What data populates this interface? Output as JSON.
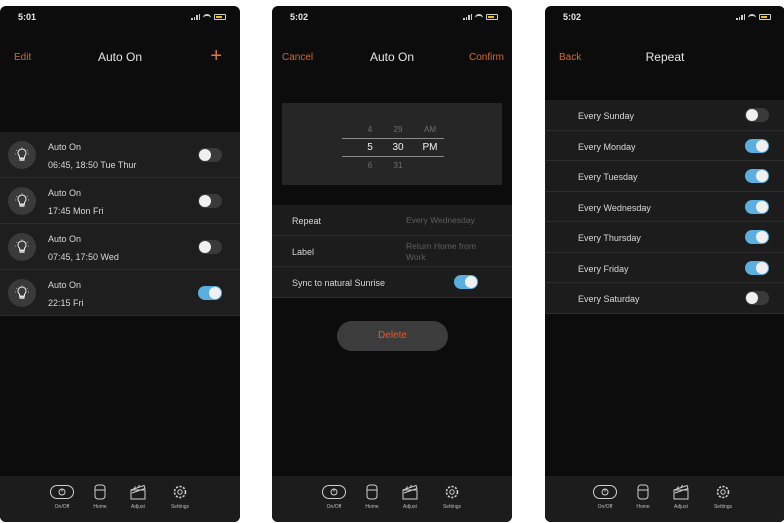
{
  "screens": [
    {
      "status_time": "5:01",
      "nav": {
        "left": "Edit",
        "title": "Auto On",
        "right_icon": "plus-icon",
        "right": "+"
      },
      "schedules": [
        {
          "name": "Auto On",
          "schedule": "06:45, 18:50 Tue Thur",
          "enabled": false
        },
        {
          "name": "Auto On",
          "schedule": "17:45 Mon Fri",
          "enabled": false
        },
        {
          "name": "Auto On",
          "schedule": "07:45, 17:50 Wed",
          "enabled": false
        },
        {
          "name": "Auto On",
          "schedule": "22:15 Fri",
          "enabled": true
        }
      ]
    },
    {
      "status_time": "5:02",
      "nav": {
        "left": "Cancel",
        "title": "Auto On",
        "right": "Confirm"
      },
      "picker": {
        "hours": [
          "4",
          "5",
          "6"
        ],
        "minutes": [
          "29",
          "30",
          "31"
        ],
        "periods": [
          "AM",
          "PM",
          ""
        ]
      },
      "repeat": {
        "label": "Repeat",
        "value": "Every Wednesday"
      },
      "name_field": {
        "label": "Label",
        "value": "Return Home from Work"
      },
      "sunrise": {
        "label": "Sync to natural Sunrise",
        "enabled": true
      },
      "delete_label": "Delete"
    },
    {
      "status_time": "5:02",
      "nav": {
        "left": "Back",
        "title": "Repeat"
      },
      "days": [
        {
          "label": "Every Sunday",
          "enabled": false
        },
        {
          "label": "Every Monday",
          "enabled": true
        },
        {
          "label": "Every Tuesday",
          "enabled": true
        },
        {
          "label": "Every Wednesday",
          "enabled": true
        },
        {
          "label": "Every Thursday",
          "enabled": true
        },
        {
          "label": "Every Friday",
          "enabled": true
        },
        {
          "label": "Every Saturday",
          "enabled": false
        }
      ]
    }
  ],
  "tabbar": [
    {
      "label": "On/Off",
      "icon": "power-icon"
    },
    {
      "label": "Home",
      "icon": "home-device-icon"
    },
    {
      "label": "Adjust",
      "icon": "clapperboard-icon"
    },
    {
      "label": "Settings",
      "icon": "gear-icon"
    }
  ],
  "colors": {
    "accent": "#d66a2e",
    "toggle_on": "#5aaee0",
    "delete": "#e45a2c",
    "background": "#0c0c0c"
  }
}
